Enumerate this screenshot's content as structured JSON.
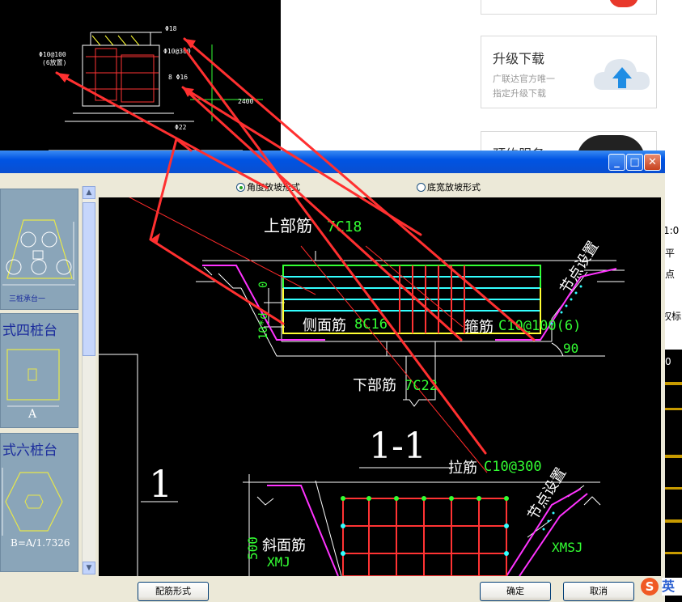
{
  "background_cad": {
    "labels": [
      "Φ10@100",
      "(6放置)",
      "Φ18",
      "Φ10@300",
      "8 Φ16",
      "Φ22",
      "2400"
    ]
  },
  "web_sidebar": {
    "upgrade_title": "升级下载",
    "upgrade_sub1": "广联达官方唯一",
    "upgrade_sub2": "指定升级下载",
    "service_title": "预约服务"
  },
  "dialog": {
    "titlebar_buttons": {
      "minimize": "_",
      "maximize": "□",
      "close": "✕"
    },
    "radio_angle": "角度放坡形式",
    "radio_width": "底宽放坡形式",
    "thumbnails": [
      {
        "caption": "三桩承台一",
        "title": ""
      },
      {
        "title": "式四桩台",
        "dim": "A"
      },
      {
        "title": "式六桩台",
        "dim": "B=A/1.7326"
      }
    ],
    "buttons": {
      "config": "配筋形式",
      "ok": "确定",
      "cancel": "取消"
    }
  },
  "drawing": {
    "top_bar_label": "上部筋",
    "top_bar_value": "7C18",
    "side_bar_label": "侧面筋",
    "side_bar_value": "8C16",
    "stirrup_label": "箍筋",
    "stirrup_value": "C10@100(6)",
    "bottom_bar_label": "下部筋",
    "bottom_bar_value": "7C22",
    "node_label": "节点设置",
    "angle": "90",
    "dim_zero": "0",
    "dim_10d": "10*d",
    "section_title": "1-1",
    "section_mark": "1",
    "tie_label": "拉筋",
    "tie_value": "C10@300",
    "slope_label": "斜面筋",
    "slope_code_left": "XMJ",
    "slope_code_right": "XMSJ",
    "dim_500": "500"
  },
  "right_app": {
    "labels": [
      "1:0",
      "平",
      "点",
      "权标",
      "0"
    ]
  },
  "taskbar": {
    "ime_logo": "S",
    "ime_mode": "英"
  },
  "colors": {
    "xp_blue": "#0054e3",
    "cad_bg": "#000000",
    "annotation_red": "#ff2a2a",
    "rebar_green": "#33ff33",
    "rebar_cyan": "#33ffff",
    "rebar_yellow": "#ffff33",
    "rebar_red": "#ff3333",
    "slope_magenta": "#ff33ff"
  }
}
